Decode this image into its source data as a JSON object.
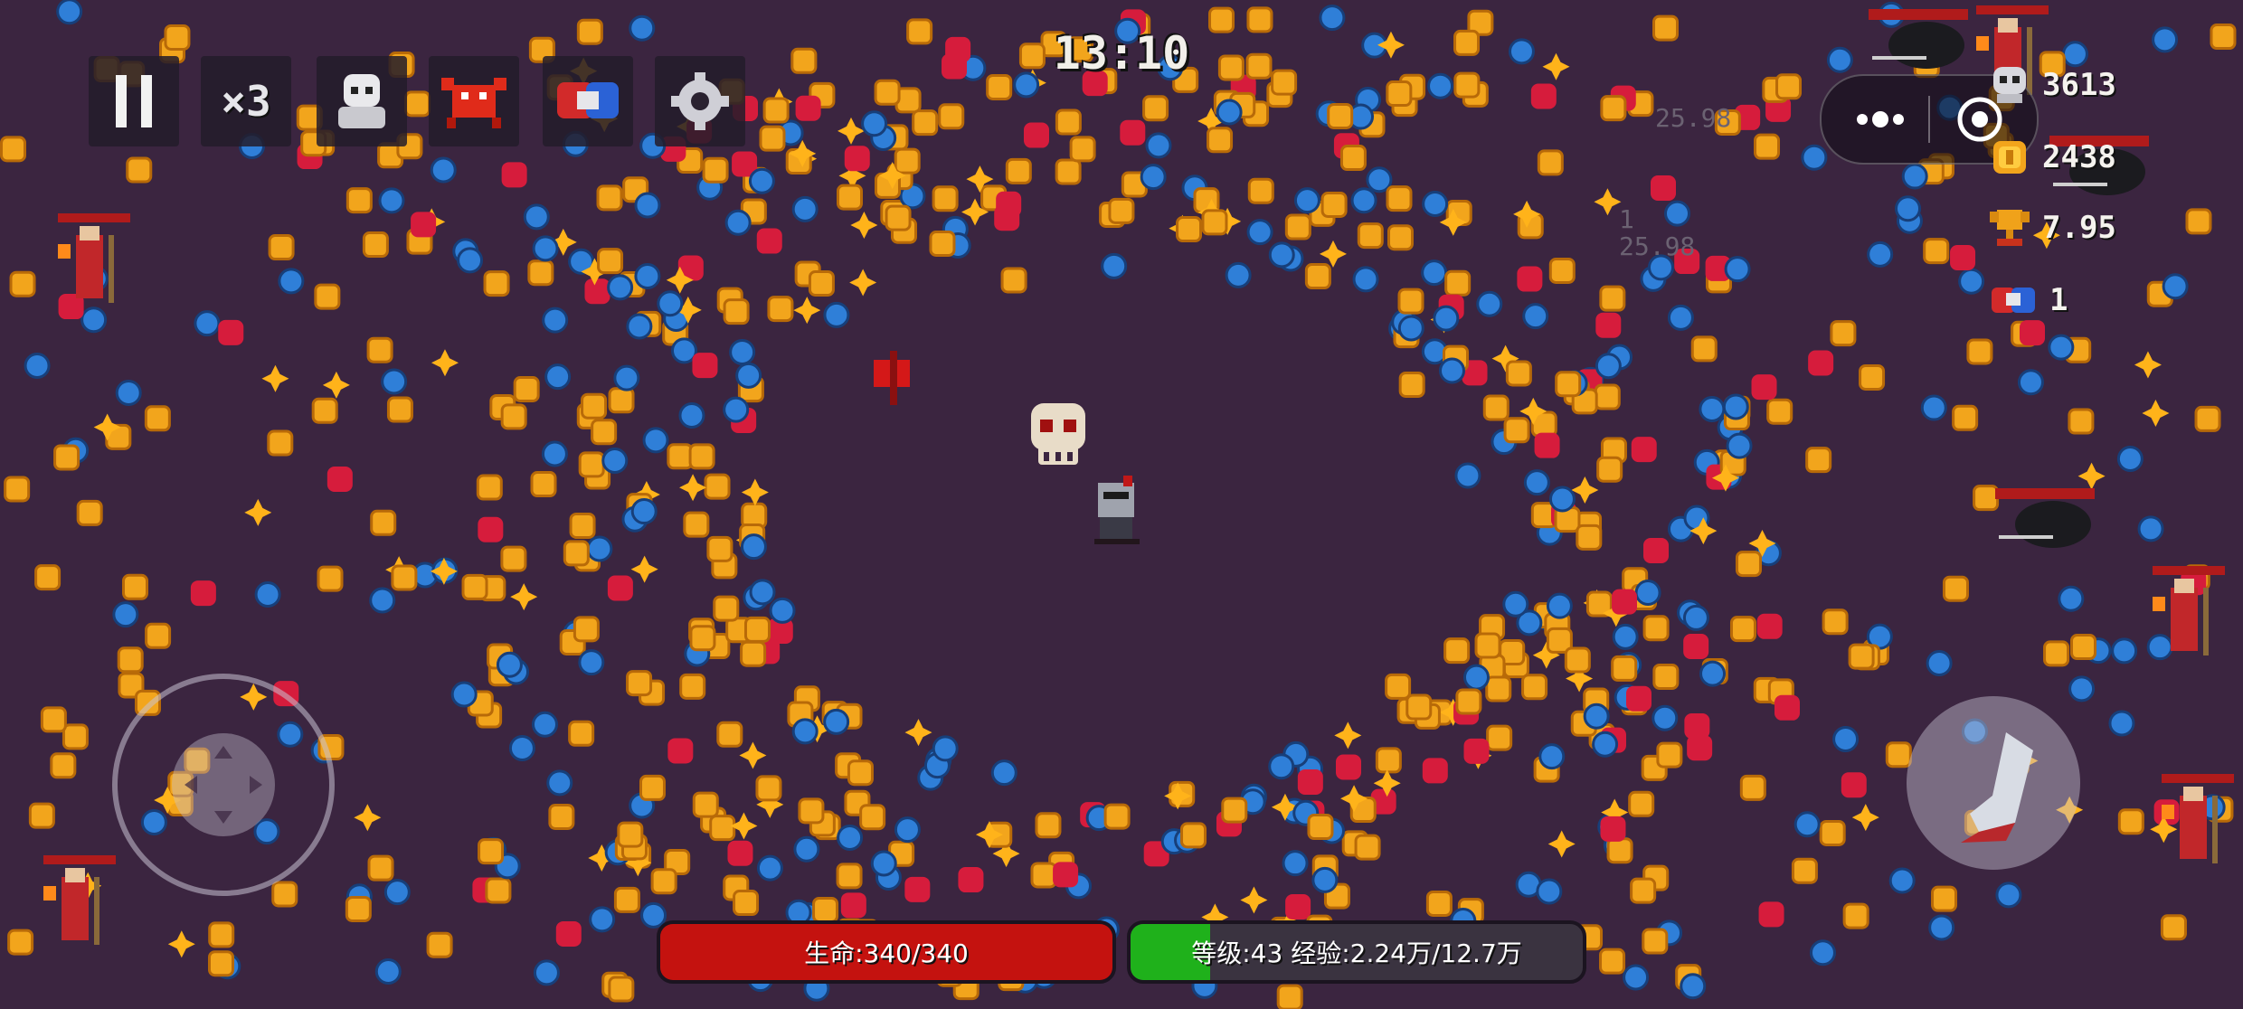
{
  "hud": {
    "timer": "13:10",
    "speed_label": "×3",
    "pause_icon": "pause-icon",
    "skill_icons": [
      "ghost-skull-icon",
      "red-crab-icon",
      "magnet-icon",
      "gear-icon"
    ]
  },
  "stats": {
    "kills": "3613",
    "gold": "2438",
    "trophy_value": "7.95",
    "magnets": "1",
    "kills_icon": "skull-icon",
    "gold_icon": "coin-icon",
    "trophy_icon": "trophy-icon",
    "magnet_icon": "magnet-icon"
  },
  "floating_numbers": [
    "25.98",
    "25.98",
    "1"
  ],
  "health_bar": {
    "label": "生命:340/340",
    "fill_fraction": 1.0,
    "color": "#c4120f"
  },
  "xp_bar": {
    "label": "等级:43  经验:2.24万/12.7万",
    "fill_fraction": 0.176,
    "color": "#1fb11b"
  },
  "capsule": {
    "more_icon": "more-dots-icon",
    "close_icon": "target-close-icon"
  },
  "colors": {
    "background": "#3b2540",
    "coin": "#f2a51c",
    "blue_gem": "#2f7fd8",
    "red_gem": "#d61c3c",
    "star": "#ffb31a"
  }
}
